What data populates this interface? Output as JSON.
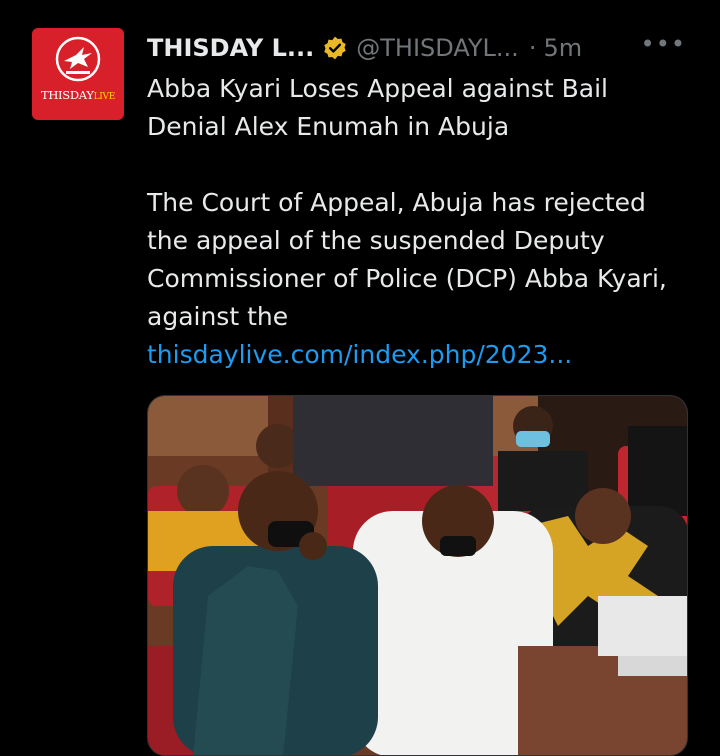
{
  "account": {
    "avatar_logo_text": "THISDAY",
    "avatar_logo_suffix": "LIVE",
    "display_name": "THISDAY L...",
    "handle": "@THISDAYL...",
    "separator": "·",
    "time": "5m",
    "more_label": "•••"
  },
  "tweet": {
    "headline_line1": "Abba Kyari Loses Appeal against Bail",
    "headline_line2": "Denial Alex Enumah in Abuja",
    "body_line1": "The Court of Appeal, Abuja has rejected",
    "body_line2": "the appeal of the suspended Deputy",
    "body_line3": "Commissioner of Police (DCP) Abba Kyari,",
    "body_line4": "against the",
    "link_text": "thisdaylive.com/index.php/2023..."
  },
  "colors": {
    "background": "#000000",
    "text": "#e7e9ea",
    "muted": "#71767b",
    "link": "#1d9bf0",
    "verified_badge": "#e8b829",
    "avatar_red": "#d8202a"
  },
  "icons": {
    "verified": "verified-badge-icon",
    "more": "more-options-icon"
  }
}
